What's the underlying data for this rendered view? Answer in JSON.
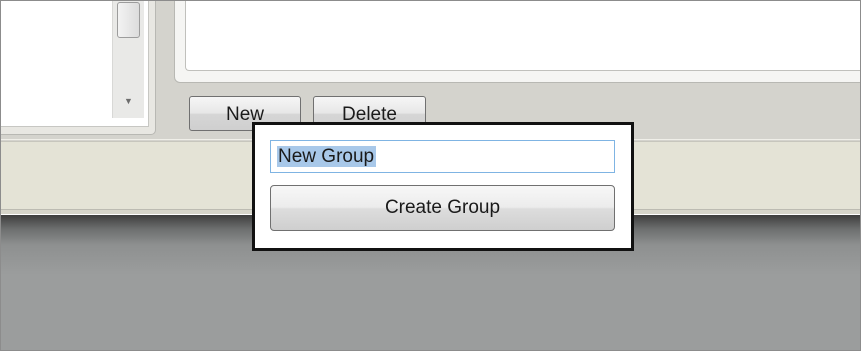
{
  "buttons": {
    "new_label": "New",
    "delete_label": "Delete"
  },
  "popup": {
    "input_value": "New Group",
    "create_label": "Create Group"
  },
  "colors": {
    "selection_highlight": "#a8c8e9",
    "input_focus_border": "#7fb4e3",
    "popup_border": "#111111"
  },
  "icons": {
    "scroll_down": "scroll-down-arrow-icon"
  }
}
